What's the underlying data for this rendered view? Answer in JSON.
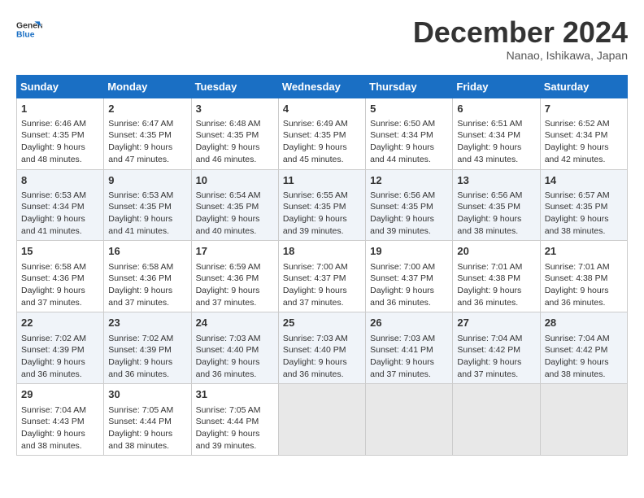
{
  "header": {
    "logo_line1": "General",
    "logo_line2": "Blue",
    "month_title": "December 2024",
    "subtitle": "Nanao, Ishikawa, Japan"
  },
  "weekdays": [
    "Sunday",
    "Monday",
    "Tuesday",
    "Wednesday",
    "Thursday",
    "Friday",
    "Saturday"
  ],
  "weeks": [
    [
      {
        "day": "1",
        "info": "Sunrise: 6:46 AM\nSunset: 4:35 PM\nDaylight: 9 hours and 48 minutes."
      },
      {
        "day": "2",
        "info": "Sunrise: 6:47 AM\nSunset: 4:35 PM\nDaylight: 9 hours and 47 minutes."
      },
      {
        "day": "3",
        "info": "Sunrise: 6:48 AM\nSunset: 4:35 PM\nDaylight: 9 hours and 46 minutes."
      },
      {
        "day": "4",
        "info": "Sunrise: 6:49 AM\nSunset: 4:35 PM\nDaylight: 9 hours and 45 minutes."
      },
      {
        "day": "5",
        "info": "Sunrise: 6:50 AM\nSunset: 4:34 PM\nDaylight: 9 hours and 44 minutes."
      },
      {
        "day": "6",
        "info": "Sunrise: 6:51 AM\nSunset: 4:34 PM\nDaylight: 9 hours and 43 minutes."
      },
      {
        "day": "7",
        "info": "Sunrise: 6:52 AM\nSunset: 4:34 PM\nDaylight: 9 hours and 42 minutes."
      }
    ],
    [
      {
        "day": "8",
        "info": "Sunrise: 6:53 AM\nSunset: 4:34 PM\nDaylight: 9 hours and 41 minutes."
      },
      {
        "day": "9",
        "info": "Sunrise: 6:53 AM\nSunset: 4:35 PM\nDaylight: 9 hours and 41 minutes."
      },
      {
        "day": "10",
        "info": "Sunrise: 6:54 AM\nSunset: 4:35 PM\nDaylight: 9 hours and 40 minutes."
      },
      {
        "day": "11",
        "info": "Sunrise: 6:55 AM\nSunset: 4:35 PM\nDaylight: 9 hours and 39 minutes."
      },
      {
        "day": "12",
        "info": "Sunrise: 6:56 AM\nSunset: 4:35 PM\nDaylight: 9 hours and 39 minutes."
      },
      {
        "day": "13",
        "info": "Sunrise: 6:56 AM\nSunset: 4:35 PM\nDaylight: 9 hours and 38 minutes."
      },
      {
        "day": "14",
        "info": "Sunrise: 6:57 AM\nSunset: 4:35 PM\nDaylight: 9 hours and 38 minutes."
      }
    ],
    [
      {
        "day": "15",
        "info": "Sunrise: 6:58 AM\nSunset: 4:36 PM\nDaylight: 9 hours and 37 minutes."
      },
      {
        "day": "16",
        "info": "Sunrise: 6:58 AM\nSunset: 4:36 PM\nDaylight: 9 hours and 37 minutes."
      },
      {
        "day": "17",
        "info": "Sunrise: 6:59 AM\nSunset: 4:36 PM\nDaylight: 9 hours and 37 minutes."
      },
      {
        "day": "18",
        "info": "Sunrise: 7:00 AM\nSunset: 4:37 PM\nDaylight: 9 hours and 37 minutes."
      },
      {
        "day": "19",
        "info": "Sunrise: 7:00 AM\nSunset: 4:37 PM\nDaylight: 9 hours and 36 minutes."
      },
      {
        "day": "20",
        "info": "Sunrise: 7:01 AM\nSunset: 4:38 PM\nDaylight: 9 hours and 36 minutes."
      },
      {
        "day": "21",
        "info": "Sunrise: 7:01 AM\nSunset: 4:38 PM\nDaylight: 9 hours and 36 minutes."
      }
    ],
    [
      {
        "day": "22",
        "info": "Sunrise: 7:02 AM\nSunset: 4:39 PM\nDaylight: 9 hours and 36 minutes."
      },
      {
        "day": "23",
        "info": "Sunrise: 7:02 AM\nSunset: 4:39 PM\nDaylight: 9 hours and 36 minutes."
      },
      {
        "day": "24",
        "info": "Sunrise: 7:03 AM\nSunset: 4:40 PM\nDaylight: 9 hours and 36 minutes."
      },
      {
        "day": "25",
        "info": "Sunrise: 7:03 AM\nSunset: 4:40 PM\nDaylight: 9 hours and 36 minutes."
      },
      {
        "day": "26",
        "info": "Sunrise: 7:03 AM\nSunset: 4:41 PM\nDaylight: 9 hours and 37 minutes."
      },
      {
        "day": "27",
        "info": "Sunrise: 7:04 AM\nSunset: 4:42 PM\nDaylight: 9 hours and 37 minutes."
      },
      {
        "day": "28",
        "info": "Sunrise: 7:04 AM\nSunset: 4:42 PM\nDaylight: 9 hours and 38 minutes."
      }
    ],
    [
      {
        "day": "29",
        "info": "Sunrise: 7:04 AM\nSunset: 4:43 PM\nDaylight: 9 hours and 38 minutes."
      },
      {
        "day": "30",
        "info": "Sunrise: 7:05 AM\nSunset: 4:44 PM\nDaylight: 9 hours and 38 minutes."
      },
      {
        "day": "31",
        "info": "Sunrise: 7:05 AM\nSunset: 4:44 PM\nDaylight: 9 hours and 39 minutes."
      },
      {
        "day": "",
        "info": ""
      },
      {
        "day": "",
        "info": ""
      },
      {
        "day": "",
        "info": ""
      },
      {
        "day": "",
        "info": ""
      }
    ]
  ]
}
